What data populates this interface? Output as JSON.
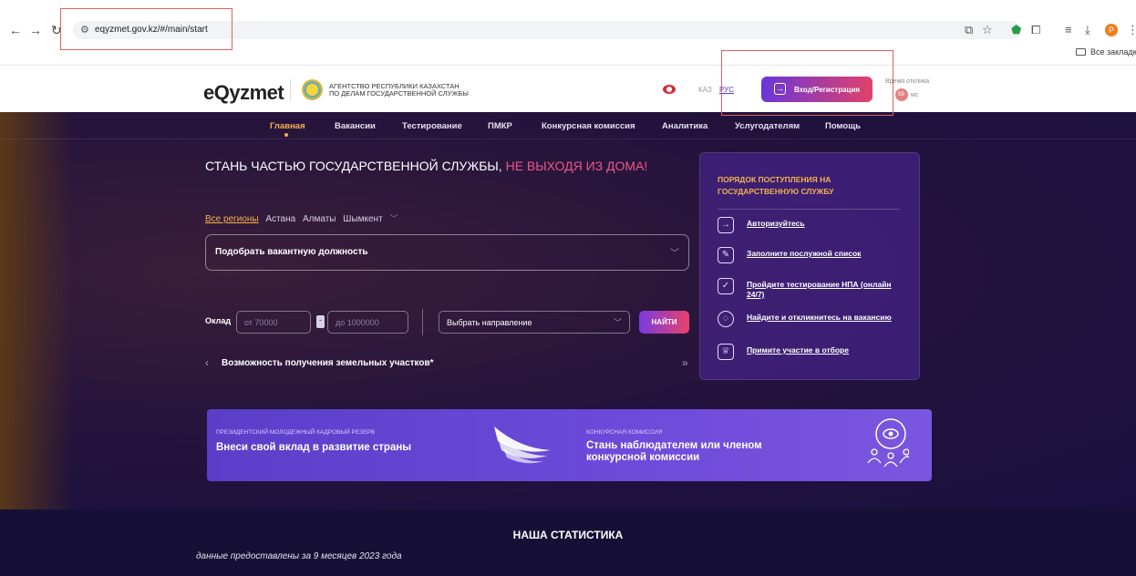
{
  "browser": {
    "url": "eqyzmet.gov.kz/#/main/start",
    "bookmarks_label": "Все закладк",
    "profile_initial": "P"
  },
  "header": {
    "logo": "eQyzmet",
    "agency_line1": "АГЕНТСТВО РЕСПУБЛИКИ КАЗАХСТАН",
    "agency_line2": "ПО ДЕЛАМ ГОСУДАРСТВЕННОЙ СЛУЖБЫ",
    "languages": [
      "КАЗ",
      "РУС"
    ],
    "active_language": "РУС",
    "login_label": "Вход/Регистрация",
    "response_time_label": "Время отклика",
    "response_time_value": "59",
    "response_time_unit": "мс"
  },
  "menu": {
    "items": [
      "Главная",
      "Вакансии",
      "Тестирование",
      "ПМКР",
      "Конкурсная комиссия",
      "Аналитика",
      "Услугодателям",
      "Помощь"
    ],
    "active": "Главная"
  },
  "hero": {
    "title_main": "СТАНЬ ЧАСТЬЮ ГОСУДАРСТВЕННОЙ СЛУЖБЫ, ",
    "title_highlight": "НЕ ВЫХОДЯ ИЗ ДОМА!",
    "regions": [
      "Все регионы",
      "Астана",
      "Алматы",
      "Шымкент"
    ],
    "vacancy_placeholder": "Подобрать вакантную должность",
    "salary_label": "Оклад",
    "salary_from_placeholder": "от 70000",
    "salary_to_placeholder": "до 1000000",
    "direction_placeholder": "Выбрать направление",
    "find_label": "НАЙТИ",
    "slider_text": "Возможность получения земельных участков*"
  },
  "admission": {
    "title": "ПОРЯДОК ПОСТУПЛЕНИЯ НА ГОСУДАРСТВЕННУЮ СЛУЖБУ",
    "steps": [
      "Авторизуйтесь",
      "Заполните послужной список",
      "Пройдите тестирование НПА (онлайн 24/7)",
      "Найдите и откликнитесь на вакансию",
      "Примите участие в отборе"
    ]
  },
  "cards": [
    {
      "caption": "ПРЕЗИДЕНТСКИЙ МОЛОДЕЖНЫЙ КАДРОВЫЙ РЕЗЕРВ",
      "headline": "Внеси свой вклад в развитие страны"
    },
    {
      "caption": "КОНКУРСНАЯ КОМИССИЯ",
      "headline_line1": "Стань наблюдателем или членом",
      "headline_line2": "конкурсной комиссии"
    }
  ],
  "stats": {
    "title": "НАША СТАТИСТИКА",
    "subtitle": "данные предоставлены за 9 месяцев 2023 года"
  },
  "colors": {
    "accent_orange": "#f3b14c",
    "accent_pink": "#f0568a",
    "brand_purple": "#6a36d8",
    "annotation_red": "#e06060"
  }
}
